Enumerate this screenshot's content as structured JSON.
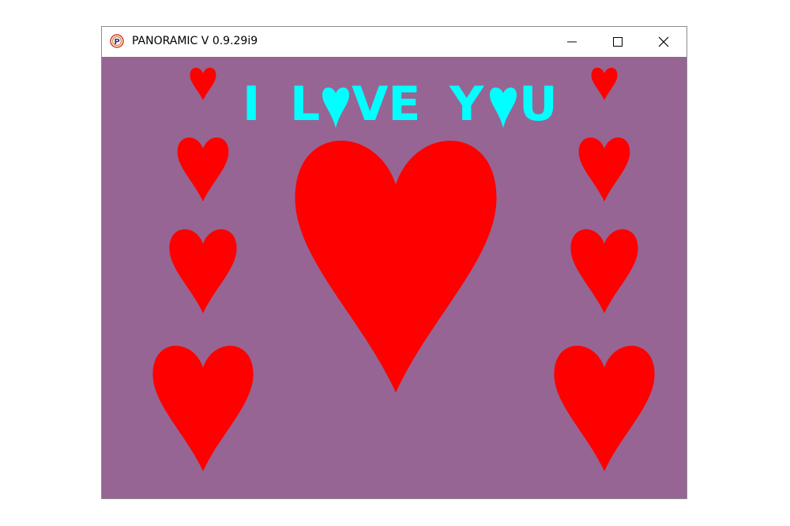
{
  "window": {
    "title": "PANORAMIC V 0.9.29i9",
    "icon": "panoramic-app-icon"
  },
  "controls": {
    "minimize_icon": "minimize-icon",
    "maximize_icon": "maximize-icon",
    "close_icon": "close-icon"
  },
  "canvas": {
    "background": "#966594",
    "heart_color": "#ff0000",
    "text_color": "#00ffff",
    "message_parts": [
      "I",
      "L",
      "VE",
      "Y",
      "U"
    ],
    "letter_heart_color": "#00ffff"
  }
}
